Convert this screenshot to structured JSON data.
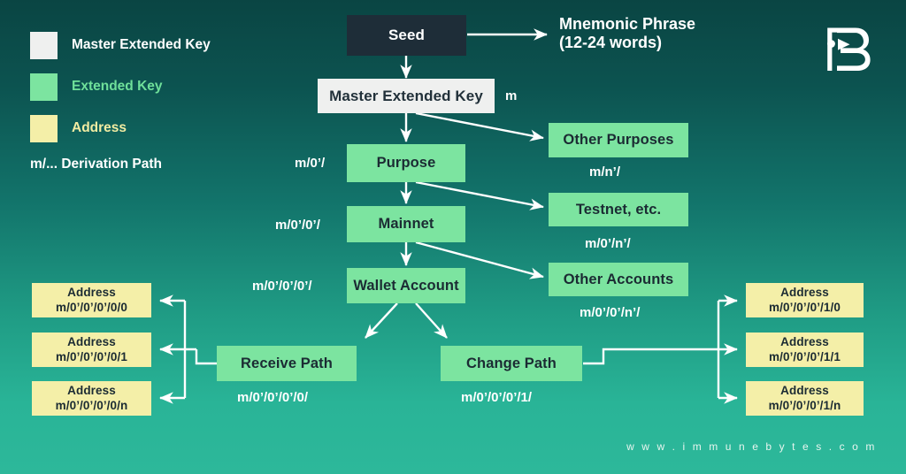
{
  "brand": {
    "logo_name": "immunebytes-ib-logo",
    "footer_url": "w w w . i m m u n e b y t e s . c o m"
  },
  "colors": {
    "background_top": "#0a4543",
    "background_bottom": "#2db89a",
    "master_key_swatch": "#eff0ef",
    "extended_key_swatch": "#7ce4a0",
    "address_swatch": "#f4efa8",
    "seed_box": "#1e2d38",
    "node_text_dark": "#1b2b33",
    "label_text": "#ffffff",
    "connector": "#ffffff"
  },
  "legend": {
    "items": [
      {
        "label": "Master Extended Key",
        "swatch": "#eff0ef",
        "text_color": "#ffffff"
      },
      {
        "label": "Extended Key",
        "swatch": "#7ce4a0",
        "text_color": "#7ce4a0"
      },
      {
        "label": "Address",
        "swatch": "#f4efa8",
        "text_color": "#f4efa8"
      }
    ],
    "note": "m/... Derivation Path"
  },
  "nodes": {
    "seed": "Seed",
    "mnemonic_line1": "Mnemonic Phrase",
    "mnemonic_line2": "(12-24 words)",
    "master_extended_key": "Master Extended Key",
    "master_path": "m",
    "purpose": "Purpose",
    "purpose_path": "m/0’/",
    "other_purposes": "Other Purposes",
    "other_purposes_path": "m/n’/",
    "mainnet": "Mainnet",
    "mainnet_path": "m/0’/0’/",
    "testnet": "Testnet, etc.",
    "testnet_path": "m/0’/n’/",
    "wallet_account": "Wallet Account",
    "wallet_account_path": "m/0’/0’/0’/",
    "other_accounts": "Other Accounts",
    "other_accounts_path": "m/0’/0’/n’/",
    "receive_path": "Receive Path",
    "receive_path_label": "m/0’/0’/0’/0/",
    "change_path": "Change Path",
    "change_path_label": "m/0’/0’/0’/1/"
  },
  "receive_addresses": [
    {
      "title": "Address",
      "path": "m/0’/0’/0’/0/0"
    },
    {
      "title": "Address",
      "path": "m/0’/0’/0’/0/1"
    },
    {
      "title": "Address",
      "path": "m/0’/0’/0’/0/n"
    }
  ],
  "change_addresses": [
    {
      "title": "Address",
      "path": "m/0’/0’/0’/1/0"
    },
    {
      "title": "Address",
      "path": "m/0’/0’/0’/1/1"
    },
    {
      "title": "Address",
      "path": "m/0’/0’/0’/1/n"
    }
  ]
}
